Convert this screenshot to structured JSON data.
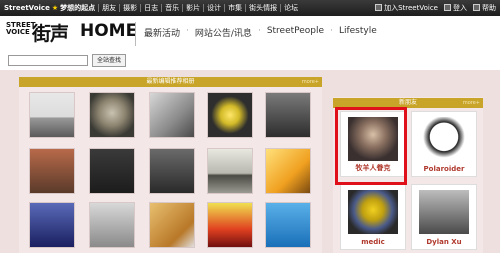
{
  "topbar": {
    "brand": "StreetVoice",
    "star": "★",
    "slogan": "梦想的起点",
    "nav": [
      "朋友",
      "摄影",
      "日志",
      "音乐",
      "影片",
      "设计",
      "市集",
      "街头情报",
      "论坛"
    ],
    "join": "加入StreetVoice",
    "login": "登入",
    "help": "帮助"
  },
  "header": {
    "logo_en_line1": "STREET",
    "logo_en_line2": "VOICE",
    "logo_cn": "街声",
    "logo_home": "HOME",
    "nav": [
      "最新活动",
      "网站公告/讯息",
      "StreetPeople",
      "Lifestyle"
    ],
    "nav_dot": "·"
  },
  "search": {
    "placeholder": "",
    "button_label": "全站查找"
  },
  "photos_section": {
    "title": "最新编辑推荐相册",
    "more": "more+"
  },
  "friends_section": {
    "title": "新朋友",
    "more": "more+",
    "friends": [
      {
        "name": "牧羊人眷克"
      },
      {
        "name": "Polaroider"
      },
      {
        "name": "medic"
      },
      {
        "name": "Dylan Xu"
      }
    ]
  },
  "colors": {
    "section_bar": "#c8a428",
    "highlight": "#e0101a",
    "name_text": "#b03a2e",
    "panel_bg": "#efe0e0"
  }
}
